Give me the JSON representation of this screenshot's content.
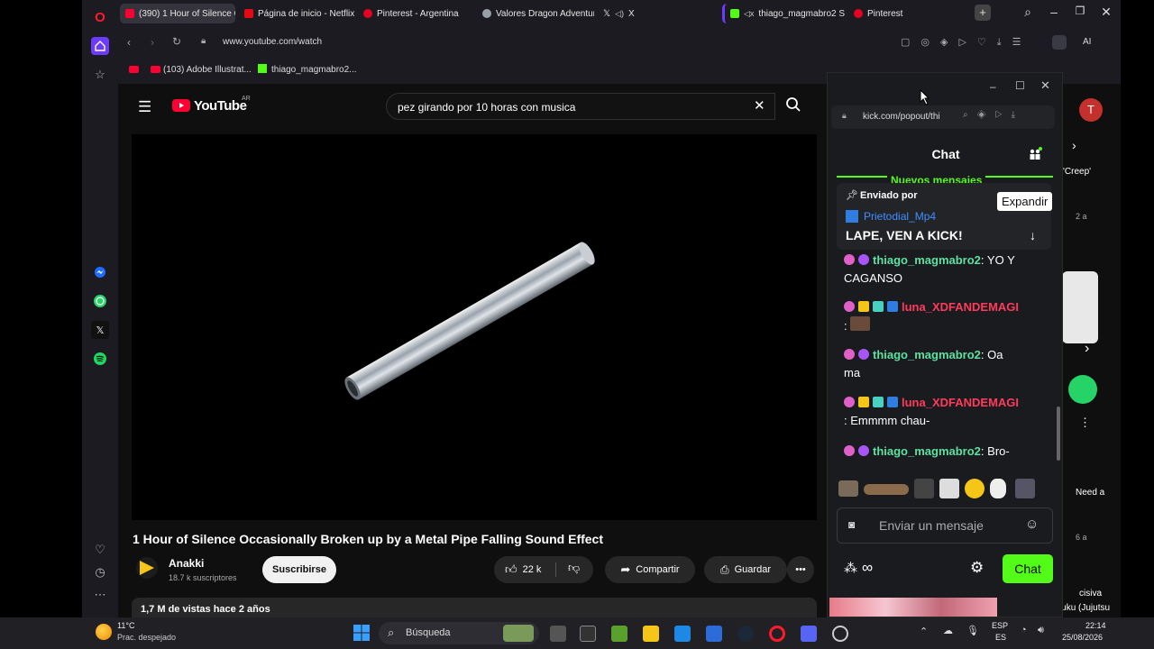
{
  "browser": {
    "tabs": [
      {
        "label": "(390) 1 Hour of Silence Oc",
        "active": true,
        "color": "#ff0033"
      },
      {
        "label": "Página de inicio - Netflix",
        "active": false,
        "color": "#e50914"
      },
      {
        "label": "Pinterest - Argentina",
        "active": false,
        "color": "#e60023"
      },
      {
        "label": "Valores Dragon Adventur",
        "active": false,
        "color": "#9aa0a6"
      },
      {
        "label": "X",
        "active": false,
        "color": "#ffffff"
      },
      {
        "label": "thiago_magmabro2 S",
        "active": false,
        "color": "#53fc18"
      },
      {
        "label": "Pinterest",
        "active": false,
        "color": "#e60023"
      }
    ],
    "url": "www.youtube.com/watch",
    "aria_label": "AI",
    "bookmarks": [
      {
        "label": "(103) Adobe Illustrat..."
      },
      {
        "label": "thiago_magmabro2..."
      }
    ]
  },
  "youtube": {
    "logo_text": "YouTube",
    "region": "AR",
    "search_query": "pez girando por 10 horas con musica",
    "video_title": "1 Hour of Silence Occasionally Broken up by a Metal Pipe Falling Sound Effect",
    "channel_name": "Anakki",
    "subscribers": "18.7 k suscriptores",
    "subscribe_label": "Suscribirse",
    "likes": "22 k",
    "share_label": "Compartir",
    "save_label": "Guardar",
    "views_meta": "1,7 M de vistas  hace 2 años",
    "side_snippets": [
      "'Creep'",
      "2 a",
      "Need a",
      "6 a",
      "cisiva",
      "en Shinjuku (Jujutsu"
    ]
  },
  "kick": {
    "url": "kick.com/popout/thi",
    "header_title": "Chat",
    "new_messages": "Nuevos mensajes",
    "pinned_label": "Enviado por",
    "pinned_user": "Prietodial_Mp4",
    "pinned_text": "LAPE, VEN A KICK!",
    "tooltip": "Expandir",
    "messages": [
      {
        "user": "thiago_magmabro2",
        "text": "YO Y",
        "cont": "CAGANSO",
        "user_color": "#5ee0a0"
      },
      {
        "user": "luna_XDFANDEMAGI",
        "text": "",
        "cont": ":",
        "user_color": "#ff3b5c"
      },
      {
        "user": "thiago_magmabro2",
        "text": ": Oa",
        "cont": "ma",
        "user_color": "#5ee0a0"
      },
      {
        "user": "luna_XDFANDEMAGI",
        "text": "",
        "cont": ": Emmmm chau-",
        "user_color": "#ff3b5c"
      },
      {
        "user": "thiago_magmabro2",
        "text": ": Bro-",
        "cont": "",
        "user_color": "#5ee0a0"
      }
    ],
    "input_placeholder": "Enviar un mensaje",
    "send_label": "Chat",
    "accent": "#53fc18"
  },
  "taskbar": {
    "temperature": "11°C",
    "weather": "Prac. despejado",
    "search_label": "Búsqueda",
    "lang": "ESP",
    "region": "ES",
    "time": "22:14",
    "date": "25/08/2026"
  }
}
